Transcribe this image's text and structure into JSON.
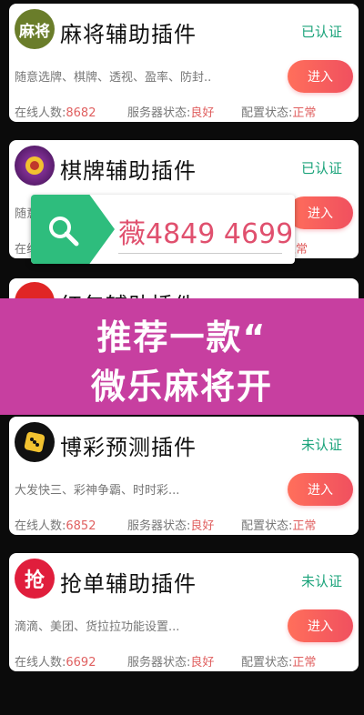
{
  "cards": [
    {
      "title": "麻将辅助插件",
      "status": "已认证",
      "desc": "随意选牌、棋牌、透视、盈率、防封..",
      "enter": "进入",
      "online_label": "在线人数:",
      "online_value": "8682",
      "server_label": "服务器状态:",
      "server_value": "良好",
      "config_label": "配置状态:",
      "config_value": "正常",
      "icon_text": "麻将",
      "icon_color": "#6a7d2a"
    },
    {
      "title": "棋牌辅助插件",
      "status": "已认证",
      "desc": "随意",
      "enter": "进入",
      "online_label": "在线",
      "online_value": "",
      "server_label": "",
      "server_value": "",
      "config_label": "",
      "config_value": "正常",
      "icon_text": "",
      "icon_color": "#5b1b6e"
    },
    {
      "title": "红包辅助插件",
      "status": "",
      "desc": "",
      "enter": "",
      "online_label": "",
      "online_value": "",
      "server_label": "",
      "server_value": "",
      "config_label": "",
      "config_value": "",
      "icon_text": "",
      "icon_color": "#e02626"
    },
    {
      "title": "博彩预测插件",
      "status": "未认证",
      "desc": "大发快三、彩神争霸、时时彩...",
      "enter": "进入",
      "online_label": "在线人数:",
      "online_value": "6852",
      "server_label": "服务器状态:",
      "server_value": "良好",
      "config_label": "配置状态:",
      "config_value": "正常",
      "icon_text": "",
      "icon_color": "#111111"
    },
    {
      "title": "抢单辅助插件",
      "status": "未认证",
      "desc": "滴滴、美团、货拉拉功能设置...",
      "enter": "进入",
      "online_label": "在线人数:",
      "online_value": "6692",
      "server_label": "服务器状态:",
      "server_value": "良好",
      "config_label": "配置状态:",
      "config_value": "正常",
      "icon_text": "抢",
      "icon_color": "#e01e3c"
    }
  ],
  "banner": {
    "wechat": "薇4849 4699",
    "icon": "search-icon",
    "color": "#2ebd7d"
  },
  "promo": {
    "line1": "推荐一款“",
    "line2": "微乐麻将开"
  }
}
